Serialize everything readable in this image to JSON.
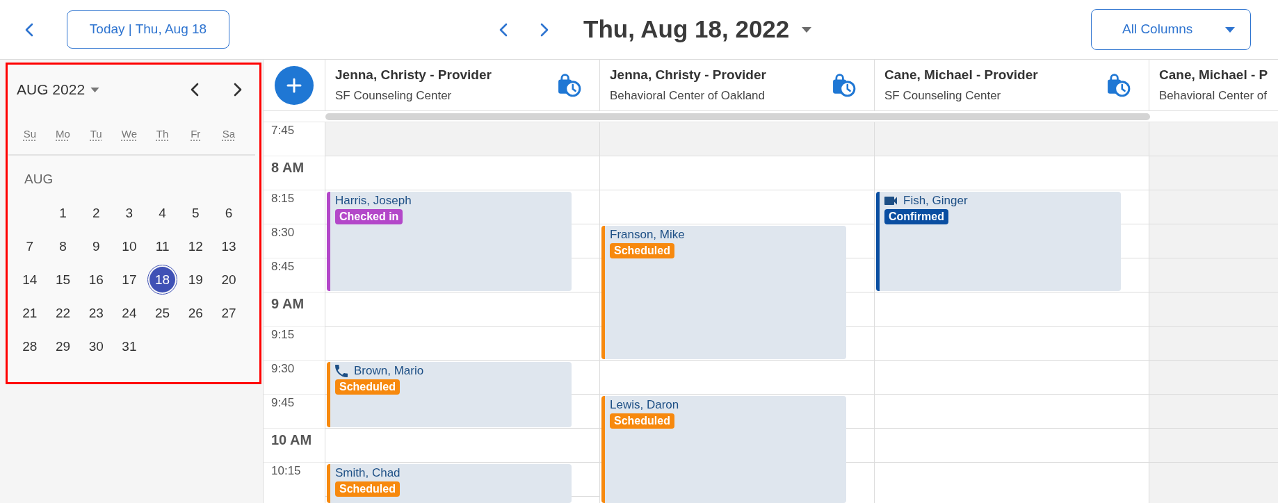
{
  "top_bar": {
    "today_button": "Today | Thu, Aug 18",
    "date_title": "Thu, Aug 18, 2022",
    "column_filter": "All Columns"
  },
  "mini_calendar": {
    "highlighted": true,
    "month_label": "AUG 2022",
    "weekdays": [
      "Su",
      "Mo",
      "Tu",
      "We",
      "Th",
      "Fr",
      "Sa"
    ],
    "section_label": "AUG",
    "weeks": [
      {
        "days": [
          {
            "day": "1",
            "selected": false
          },
          {
            "day": "2",
            "selected": false
          },
          {
            "day": "3",
            "selected": false
          },
          {
            "day": "4",
            "selected": false
          },
          {
            "day": "5",
            "selected": false
          },
          {
            "day": "6",
            "selected": false
          }
        ]
      },
      {
        "days": [
          {
            "day": "7",
            "selected": false
          },
          {
            "day": "8",
            "selected": false
          },
          {
            "day": "9",
            "selected": false
          },
          {
            "day": "10",
            "selected": false
          },
          {
            "day": "11",
            "selected": false
          },
          {
            "day": "12",
            "selected": false
          },
          {
            "day": "13",
            "selected": false
          }
        ]
      },
      {
        "days": [
          {
            "day": "14",
            "selected": false
          },
          {
            "day": "15",
            "selected": false
          },
          {
            "day": "16",
            "selected": false
          },
          {
            "day": "17",
            "selected": false
          },
          {
            "day": "18",
            "selected": true
          },
          {
            "day": "19",
            "selected": false
          },
          {
            "day": "20",
            "selected": false
          }
        ]
      },
      {
        "days": [
          {
            "day": "21",
            "selected": false
          },
          {
            "day": "22",
            "selected": false
          },
          {
            "day": "23",
            "selected": false
          },
          {
            "day": "24",
            "selected": false
          },
          {
            "day": "25",
            "selected": false
          },
          {
            "day": "26",
            "selected": false
          },
          {
            "day": "27",
            "selected": false
          }
        ]
      },
      {
        "days": [
          {
            "day": "28",
            "selected": false
          },
          {
            "day": "29",
            "selected": false
          },
          {
            "day": "30",
            "selected": false
          },
          {
            "day": "31",
            "selected": false
          }
        ]
      }
    ]
  },
  "schedule": {
    "time_slots": [
      {
        "label": "7:45",
        "kind": "quarter"
      },
      {
        "label": "8 AM",
        "kind": "hour"
      },
      {
        "label": "8:15",
        "kind": "quarter"
      },
      {
        "label": "8:30",
        "kind": "quarter"
      },
      {
        "label": "8:45",
        "kind": "quarter"
      },
      {
        "label": "9 AM",
        "kind": "hour"
      },
      {
        "label": "9:15",
        "kind": "quarter"
      },
      {
        "label": "9:30",
        "kind": "quarter"
      },
      {
        "label": "9:45",
        "kind": "quarter"
      },
      {
        "label": "10 AM",
        "kind": "hour"
      },
      {
        "label": "10:15",
        "kind": "quarter"
      }
    ],
    "columns": [
      {
        "provider": "Jenna, Christy - Provider",
        "location": "SF Counseling Center",
        "cut_off": false,
        "cells": [
          {
            "kind": "closed"
          },
          {
            "kind": "open"
          },
          {
            "kind": "appointment",
            "patient": "Harris, Joseph",
            "status": "Checked in",
            "color": "#b347c9",
            "phone_call": false,
            "video_call": false
          },
          {
            "kind": "continued"
          },
          {
            "kind": "continued"
          },
          {
            "kind": "open"
          },
          {
            "kind": "open"
          },
          {
            "kind": "appointment",
            "patient": "Brown, Mario",
            "status": "Scheduled",
            "color": "#f7890e",
            "phone_call": true,
            "video_call": false
          },
          {
            "kind": "continued"
          },
          {
            "kind": "open"
          },
          {
            "kind": "appointment",
            "patient": "Smith, Chad",
            "status": "Scheduled",
            "color": "#f7890e",
            "phone_call": false,
            "video_call": false
          }
        ]
      },
      {
        "provider": "Jenna, Christy - Provider",
        "location": "Behavioral Center of Oakland",
        "cut_off": false,
        "cells": [
          {
            "kind": "closed"
          },
          {
            "kind": "open"
          },
          {
            "kind": "open"
          },
          {
            "kind": "appointment",
            "patient": "Franson, Mike",
            "status": "Scheduled",
            "color": "#f7890e",
            "phone_call": false,
            "video_call": false
          },
          {
            "kind": "continued"
          },
          {
            "kind": "continued"
          },
          {
            "kind": "continued"
          },
          {
            "kind": "open"
          },
          {
            "kind": "appointment",
            "patient": "Lewis, Daron",
            "status": "Scheduled",
            "color": "#f7890e",
            "phone_call": false,
            "video_call": false
          },
          {
            "kind": "continued"
          },
          {
            "kind": "continued"
          }
        ]
      },
      {
        "provider": "Cane, Michael - Provider",
        "location": "SF Counseling Center",
        "cut_off": false,
        "cells": [
          {
            "kind": "closed"
          },
          {
            "kind": "open"
          },
          {
            "kind": "appointment",
            "patient": "Fish, Ginger",
            "status": "Confirmed",
            "color": "#0a4ea1",
            "phone_call": false,
            "video_call": true
          },
          {
            "kind": "continued"
          },
          {
            "kind": "continued"
          },
          {
            "kind": "open"
          },
          {
            "kind": "open"
          },
          {
            "kind": "open"
          },
          {
            "kind": "open"
          },
          {
            "kind": "open"
          },
          {
            "kind": "open"
          }
        ]
      },
      {
        "provider": "Cane, Michael - P",
        "location": "Behavioral Center of",
        "cut_off": true,
        "cells": [
          {
            "kind": "closed"
          },
          {
            "kind": "closed"
          },
          {
            "kind": "closed"
          },
          {
            "kind": "closed"
          },
          {
            "kind": "closed"
          },
          {
            "kind": "closed"
          },
          {
            "kind": "closed"
          },
          {
            "kind": "closed"
          },
          {
            "kind": "closed"
          },
          {
            "kind": "closed"
          },
          {
            "kind": "closed"
          }
        ]
      }
    ]
  }
}
